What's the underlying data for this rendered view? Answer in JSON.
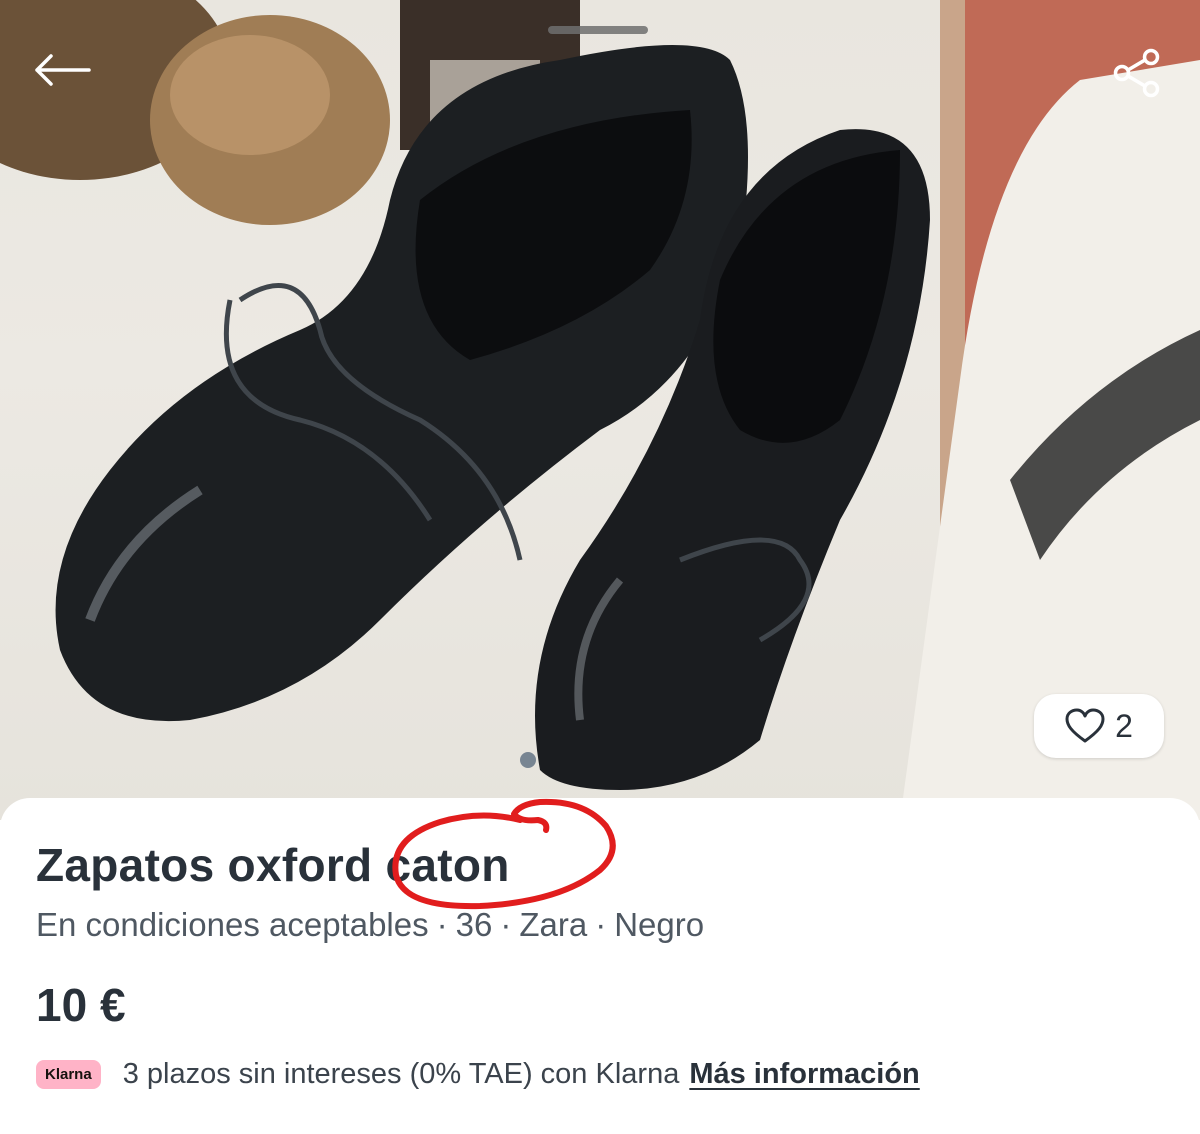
{
  "header": {
    "back_icon": "arrow-left-icon",
    "share_icon": "share-icon"
  },
  "photo": {
    "description_icons": [
      "heart-icon"
    ],
    "favorites": {
      "icon": "heart-icon",
      "count": "2"
    }
  },
  "listing": {
    "title": "Zapatos oxford caton",
    "condition": "En condiciones aceptables",
    "size": "36",
    "brand": "Zara",
    "color": "Negro",
    "separator": "·",
    "price": "10 €"
  },
  "klarna": {
    "badge": "Klarna",
    "text": "3 plazos sin intereses (0% TAE) con Klarna",
    "link": "Más información"
  },
  "colors": {
    "annotation": "#e11d1d",
    "text_primary": "#29313a",
    "klarna_pink": "#ffb3c7"
  }
}
